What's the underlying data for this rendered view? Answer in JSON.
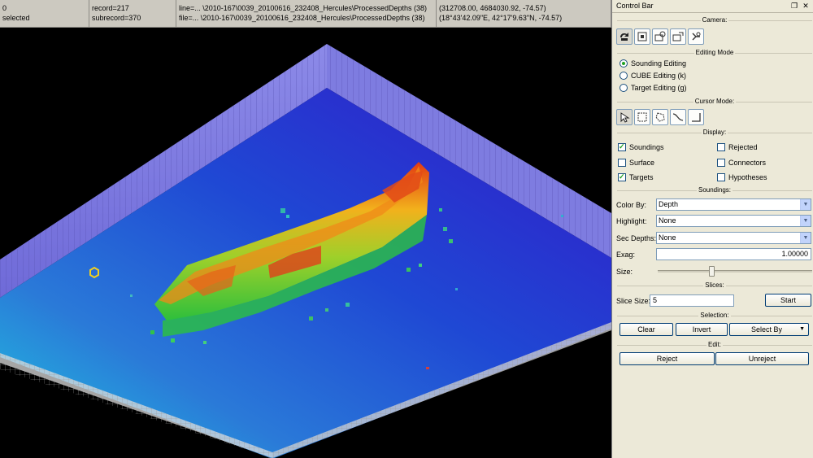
{
  "status_bar": {
    "cell1": {
      "line1": "0",
      "line2": "selected"
    },
    "cell2": {
      "line1": "record=217",
      "line2": "subrecord=370"
    },
    "cell3": {
      "line1": "line=... \\2010-167\\0039_20100616_232408_Hercules\\ProcessedDepths (38)",
      "line2": "file=... \\2010-167\\0039_20100616_232408_Hercules\\ProcessedDepths (38)"
    },
    "cell4": {
      "line1": "(312708.00, 4684030.92, -74.57)",
      "line2": "(18°43'42.09\"E, 42°17'9.63\"N, -74.57)"
    }
  },
  "control_bar": {
    "title": "Control Bar",
    "restore_glyph": "❐",
    "close_glyph": "✕",
    "camera": {
      "title": "Camera:",
      "buttons": [
        "camera-rotate-icon",
        "camera-pan-icon",
        "camera-zoom-icon",
        "camera-orbit-icon",
        "camera-reset-icon"
      ]
    },
    "editing_mode": {
      "title": "Editing Mode",
      "options": [
        {
          "label": "Sounding Editing",
          "selected": true
        },
        {
          "label": "CUBE Editing (k)",
          "selected": false
        },
        {
          "label": "Target Editing (g)",
          "selected": false
        }
      ]
    },
    "cursor_mode": {
      "title": "Cursor Mode:",
      "buttons": [
        "pointer-icon",
        "rectangle-select-icon",
        "lasso-select-icon",
        "curve-select-icon",
        "profile-select-icon"
      ]
    },
    "display": {
      "title": "Display:",
      "checkboxes": [
        {
          "label": "Soundings",
          "checked": true
        },
        {
          "label": "Rejected",
          "checked": false
        },
        {
          "label": "Surface",
          "checked": false
        },
        {
          "label": "Connectors",
          "checked": false
        },
        {
          "label": "Targets",
          "checked": true
        },
        {
          "label": "Hypotheses",
          "checked": false
        }
      ]
    },
    "soundings": {
      "title": "Soundings:",
      "color_by_label": "Color By:",
      "color_by_value": "Depth",
      "highlight_label": "Highlight:",
      "highlight_value": "None",
      "sec_depths_label": "Sec Depths:",
      "sec_depths_value": "None",
      "exag_label": "Exag:",
      "exag_value": "1.00000",
      "size_label": "Size:",
      "size_level": 0.35
    },
    "slices": {
      "title": "Slices:",
      "slice_size_label": "Slice Size:",
      "slice_size_value": "5",
      "start_label": "Start"
    },
    "selection": {
      "title": "Selection:",
      "clear_label": "Clear",
      "invert_label": "Invert",
      "select_by_label": "Select By"
    },
    "edit": {
      "title": "Edit:",
      "reject_label": "Reject",
      "unreject_label": "Unreject"
    }
  },
  "colors": {
    "seafloor_deep": "#1a2fd0",
    "seafloor_mid": "#2a6fd8",
    "seafloor_shallow": "#1fb8d8",
    "wall": "#8a86e8",
    "wreck_high": "#e03010",
    "wreck_mid": "#f0c020",
    "wreck_low": "#30c040"
  }
}
